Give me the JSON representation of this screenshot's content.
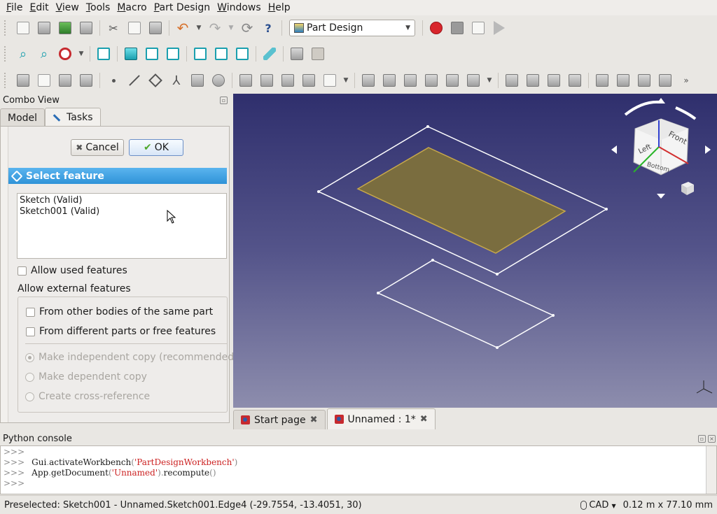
{
  "menu": [
    "File",
    "Edit",
    "View",
    "Tools",
    "Macro",
    "Part Design",
    "Windows",
    "Help"
  ],
  "toolbar": {
    "workbench": "Part Design"
  },
  "combo": {
    "title": "Combo View",
    "tabs": [
      "Model",
      "Tasks"
    ],
    "cancel_label": "Cancel",
    "ok_label": "OK"
  },
  "select_feature": {
    "title": "Select feature",
    "items": [
      "Sketch (Valid)",
      "Sketch001 (Valid)"
    ],
    "allow_used": "Allow used features",
    "allow_external": "Allow external features",
    "from_other_bodies": "From other bodies of the same part",
    "from_different_parts": "From different parts or free features",
    "options": [
      "Make independent copy (recommended)",
      "Make dependent copy",
      "Create cross-reference"
    ]
  },
  "view3d": {
    "navcube": {
      "left": "Left",
      "front": "Front",
      "bottom": "Bottom"
    }
  },
  "doc_tabs": [
    {
      "label": "Start page",
      "active": false
    },
    {
      "label": "Unnamed : 1*",
      "active": true
    }
  ],
  "python_console": {
    "title": "Python console",
    "prompt": ">>>",
    "lines": [
      {
        "obj": "Gui",
        "method": "activateWorkbench",
        "arg": "'PartDesignWorkbench'"
      },
      {
        "obj": "App",
        "method": "getDocument",
        "arg": "'Unnamed'",
        "tail": "recompute"
      }
    ]
  },
  "status": {
    "message": "Preselected: Sketch001 - Unnamed.Sketch001.Edge4 (-29.7554, -13.4051, 30)",
    "nav_style": "CAD",
    "dimensions": "0.12 m x 77.10 mm"
  }
}
